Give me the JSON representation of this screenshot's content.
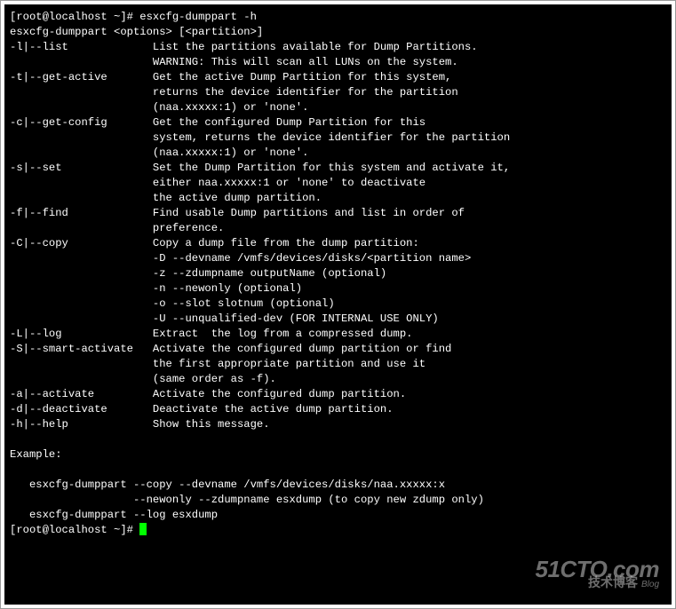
{
  "prompt1": "[root@localhost ~]# ",
  "command": "esxcfg-dumppart -h",
  "usage": "esxcfg-dumppart <options> [<partition>]",
  "options": [
    {
      "flag": "-l|--list",
      "desc": [
        "List the partitions available for Dump Partitions.",
        "WARNING: This will scan all LUNs on the system."
      ]
    },
    {
      "flag": "-t|--get-active",
      "desc": [
        "Get the active Dump Partition for this system,",
        "returns the device identifier for the partition",
        "(naa.xxxxx:1) or 'none'."
      ]
    },
    {
      "flag": "-c|--get-config",
      "desc": [
        "Get the configured Dump Partition for this",
        "system, returns the device identifier for the partition",
        "(naa.xxxxx:1) or 'none'."
      ]
    },
    {
      "flag": "-s|--set",
      "desc": [
        "Set the Dump Partition for this system and activate it,",
        "either naa.xxxxx:1 or 'none' to deactivate",
        "the active dump partition."
      ]
    },
    {
      "flag": "-f|--find",
      "desc": [
        "Find usable Dump partitions and list in order of",
        "preference."
      ]
    },
    {
      "flag": "-C|--copy",
      "desc": [
        "Copy a dump file from the dump partition:",
        "-D --devname /vmfs/devices/disks/<partition name>",
        "-z --zdumpname outputName (optional)",
        "-n --newonly (optional)",
        "-o --slot slotnum (optional)",
        "-U --unqualified-dev (FOR INTERNAL USE ONLY)"
      ]
    },
    {
      "flag": "-L|--log",
      "desc": [
        "Extract  the log from a compressed dump."
      ]
    },
    {
      "flag": "-S|--smart-activate",
      "desc": [
        "Activate the configured dump partition or find",
        "the first appropriate partition and use it",
        "(same order as -f)."
      ]
    },
    {
      "flag": "-a|--activate",
      "desc": [
        "Activate the configured dump partition."
      ]
    },
    {
      "flag": "-d|--deactivate",
      "desc": [
        "Deactivate the active dump partition."
      ]
    },
    {
      "flag": "-h|--help",
      "desc": [
        "Show this message."
      ]
    }
  ],
  "example_header": "Example:",
  "example_lines": [
    "   esxcfg-dumppart --copy --devname /vmfs/devices/disks/naa.xxxxx:x",
    "                   --newonly --zdumpname esxdump (to copy new zdump only)",
    "   esxcfg-dumppart --log esxdump"
  ],
  "prompt2": "[root@localhost ~]# ",
  "watermark": {
    "main": "51CTO.com",
    "sub": "技术博客",
    "blog": "Blog"
  },
  "col": {
    "flag_width": 22,
    "indent": 22
  }
}
